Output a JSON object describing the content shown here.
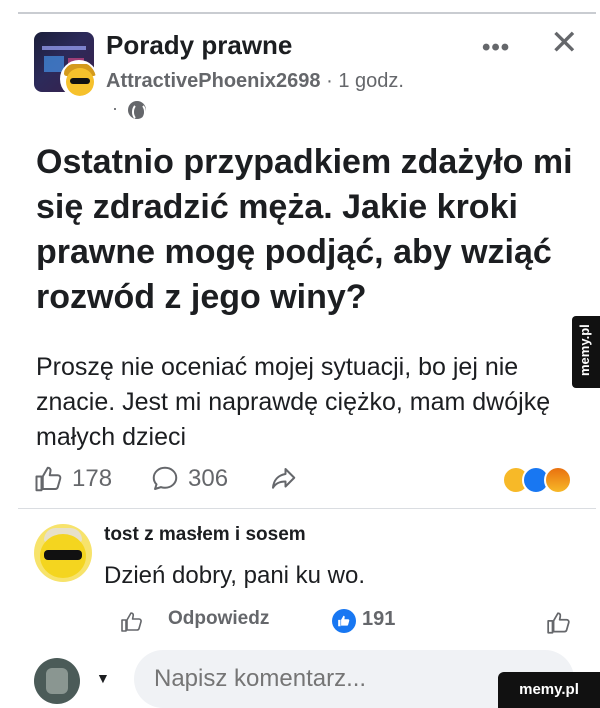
{
  "post": {
    "group_name": "Porady prawne",
    "author": "AttractivePhoenix2698",
    "time": "1 godz.",
    "privacy_dot": "·",
    "title": "Ostatnio przypadkiem zdażyło mi się zdradzić męża. Jakie kroki prawne mogę podjąć, aby wziąć rozwód z jego winy?",
    "body": "Proszę nie oceniać mojej sytuacji, bo jej nie znacie. Jest mi naprawdę ciężko, mam dwójkę małych dzieci",
    "likes": "178",
    "comments": "306"
  },
  "comment": {
    "author": "tost z masłem i sosem",
    "text": "Dzień dobry, pani ku wo.",
    "reply_label": "Odpowiedz",
    "likes": "191"
  },
  "compose": {
    "placeholder": "Napisz komentarz..."
  },
  "watermark": {
    "side": "memy.pl",
    "corner": "memy.pl"
  },
  "colors": {
    "text": "#1c1e21",
    "secondary": "#65676b",
    "accent": "#1877f2"
  },
  "icons": [
    "more-icon",
    "close-icon",
    "globe-icon",
    "like-icon",
    "comment-icon",
    "share-icon",
    "haha-reaction-icon",
    "like-reaction-icon",
    "angry-reaction-icon",
    "chevron-down-icon"
  ]
}
